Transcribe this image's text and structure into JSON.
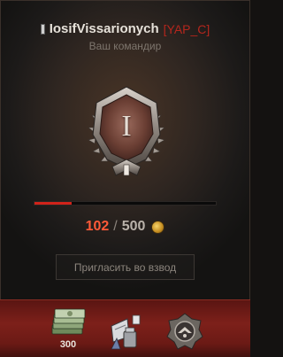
{
  "player": {
    "name": "IosifVissarionych",
    "clan": "[YAP_C]",
    "role": "Ваш командир"
  },
  "rank": {
    "numeral": "I"
  },
  "progress": {
    "current": "102",
    "separator": "/",
    "max": "500",
    "fraction": 0.204,
    "currency_icon": "coin-icon"
  },
  "invite_button": {
    "label": "Пригласить во взвод"
  },
  "rewards": {
    "items": [
      {
        "icon": "credits-stack-icon",
        "value": "300"
      },
      {
        "icon": "equipment-kit-icon"
      },
      {
        "icon": "medal-badge-icon"
      }
    ]
  },
  "colors": {
    "accent_red": "#d0231a",
    "clan_red": "#b5261d",
    "counter_orange": "#ff5a38"
  }
}
